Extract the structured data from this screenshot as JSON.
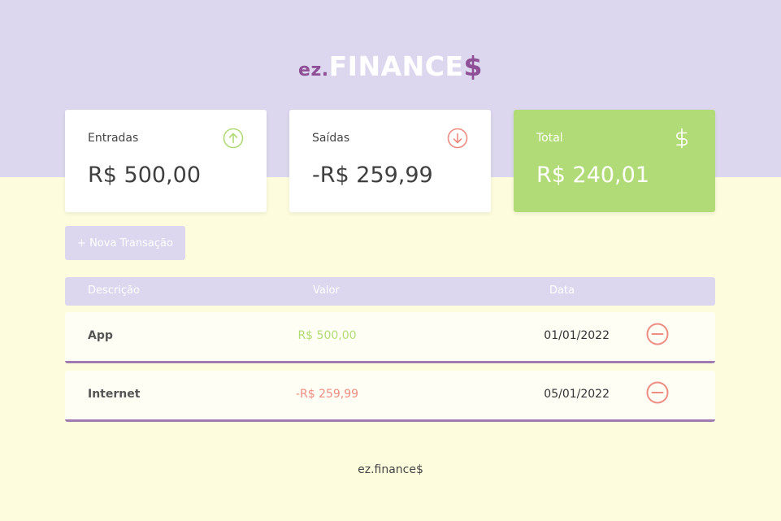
{
  "logo": {
    "prefix": "ez.",
    "main": "FINANCE",
    "suffix": "$"
  },
  "cards": {
    "income": {
      "label": "Entradas",
      "value": "R$ 500,00",
      "icon": "arrow-up-circle-icon"
    },
    "expense": {
      "label": "Saídas",
      "value": "-R$ 259,99",
      "icon": "arrow-down-circle-icon"
    },
    "total": {
      "label": "Total",
      "value": "R$ 240,01",
      "icon": "dollar-sign-icon"
    }
  },
  "new_transaction_label": "+ Nova Transação",
  "table": {
    "headers": {
      "description": "Descrição",
      "amount": "Valor",
      "date": "Data"
    },
    "rows": [
      {
        "description": "App",
        "amount": "R$ 500,00",
        "date": "01/01/2022",
        "type": "income"
      },
      {
        "description": "Internet",
        "amount": "-R$ 259,99",
        "date": "05/01/2022",
        "type": "expense"
      }
    ]
  },
  "footer": "ez.finance$",
  "colors": {
    "lavender": "#dcd7ee",
    "cream": "#fdfdde",
    "green": "#b1db77",
    "red": "#ee8b82",
    "purple": "#8e4f96"
  }
}
